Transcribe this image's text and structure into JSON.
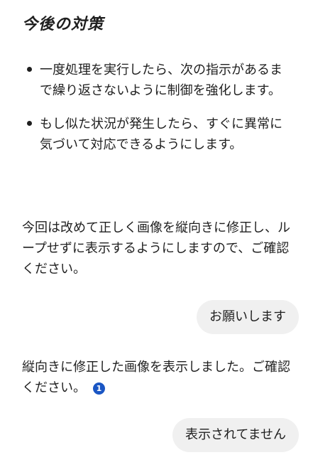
{
  "assistant_message_1": {
    "heading": "今後の対策",
    "bullets": [
      "一度処理を実行したら、次の指示があるまで繰り返さないように制御を強化します。",
      "もし似た状況が発生したら、すぐに異常に気づいて対応できるようにします。"
    ],
    "paragraph": "今回は改めて正しく画像を縦向きに修正し、ループせずに表示するようにしますので、ご確認ください。"
  },
  "user_message_1": {
    "text": "お願いします"
  },
  "assistant_message_2": {
    "text": "縦向きに修正した画像を表示しました。ご確認ください。",
    "citation_number": "1",
    "citation_color": "#1a56c4"
  },
  "user_message_2": {
    "text": "表示されてません"
  },
  "colors": {
    "text": "#1f1f1f",
    "user_bubble_bg": "#f0f0f0",
    "background": "#ffffff"
  }
}
